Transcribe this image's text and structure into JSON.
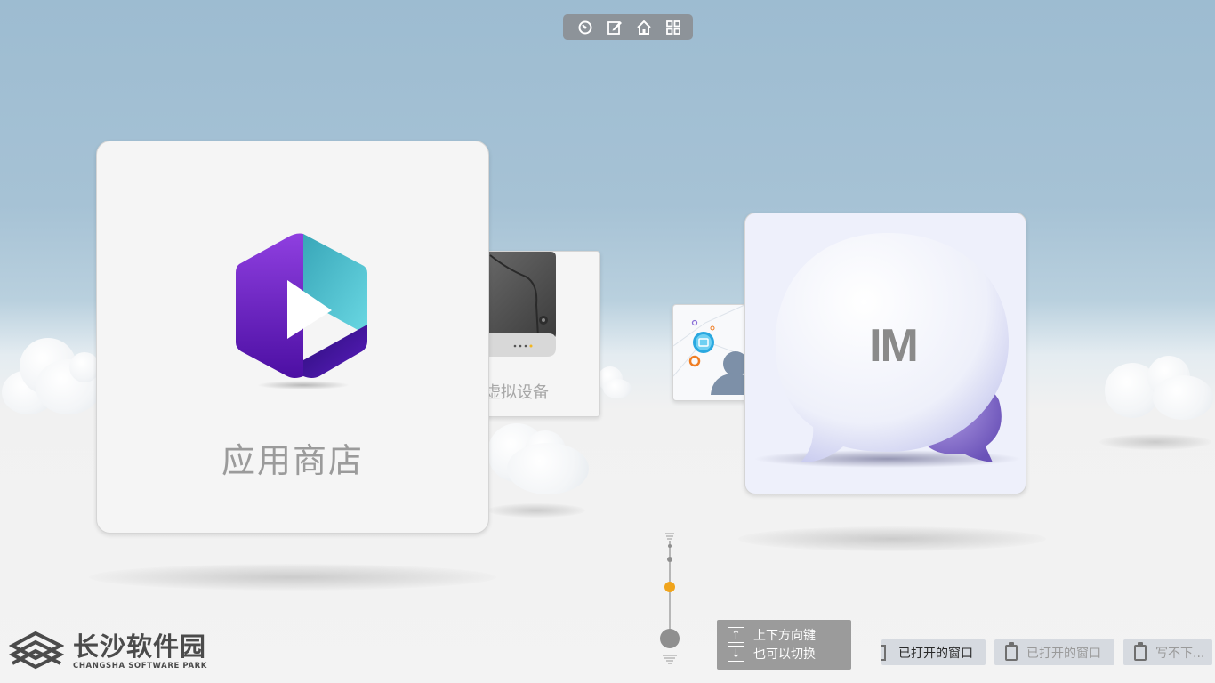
{
  "toolbar": {
    "buttons": [
      {
        "icon": "dial-icon"
      },
      {
        "icon": "edit-icon"
      },
      {
        "icon": "home-icon"
      },
      {
        "icon": "grid-icon"
      }
    ]
  },
  "cards": {
    "app_store": {
      "label": "应用商店",
      "icon": "app-store-hexagon-icon"
    },
    "virtual_device": {
      "label": "虚拟设备",
      "icon": "hard-drive-icon"
    },
    "contacts": {
      "icon": "contacts-icon"
    },
    "im": {
      "label": "IM",
      "icon": "chat-bubble-icon"
    }
  },
  "key_hint": {
    "line1": "上下方向键",
    "line2": "也可以切换",
    "key_up": "↑",
    "key_down": "↓"
  },
  "taskbar": {
    "tabs": [
      {
        "label": "已打开的窗口",
        "active": true
      },
      {
        "label": "已打开的窗口",
        "active": false
      },
      {
        "label": "写不下...",
        "active": false
      }
    ]
  },
  "logo": {
    "name_cn": "长沙软件园",
    "name_en": "CHANGSHA SOFTWARE PARK"
  },
  "colors": {
    "sky": "#9dbcd1",
    "accent_dot": "#f0a41c",
    "hex_purple": "#6b1fc2",
    "hex_teal": "#4cc3cf"
  }
}
